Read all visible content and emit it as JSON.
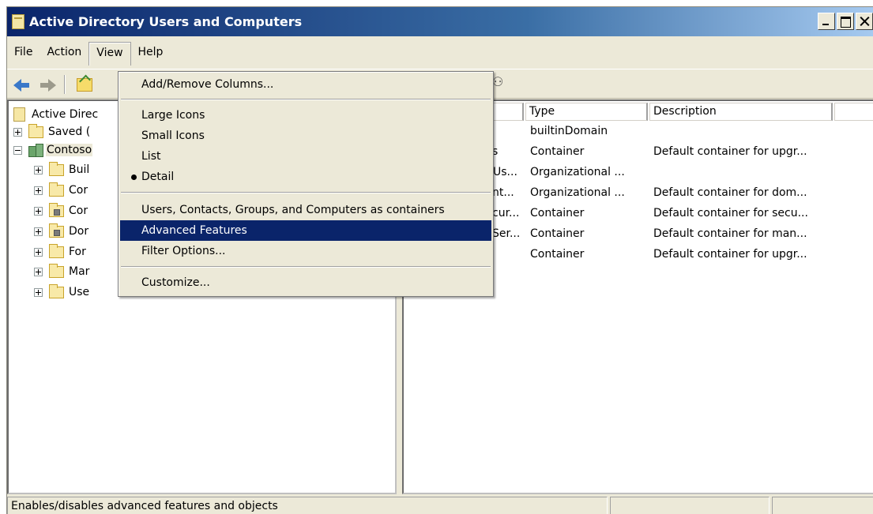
{
  "window": {
    "title": "Active Directory Users and Computers"
  },
  "menubar": {
    "items": [
      "File",
      "Action",
      "View",
      "Help"
    ]
  },
  "view_menu": {
    "items": [
      {
        "label": "Add/Remove Columns...",
        "checked": false,
        "highlighted": false
      },
      {
        "label": "Large Icons",
        "checked": false,
        "highlighted": false
      },
      {
        "label": "Small Icons",
        "checked": false,
        "highlighted": false
      },
      {
        "label": "List",
        "checked": false,
        "highlighted": false
      },
      {
        "label": "Detail",
        "checked": true,
        "highlighted": false
      },
      {
        "label": "Users, Contacts, Groups, and Computers as containers",
        "checked": false,
        "highlighted": false
      },
      {
        "label": "Advanced Features",
        "checked": false,
        "highlighted": true
      },
      {
        "label": "Filter Options...",
        "checked": false,
        "highlighted": false
      },
      {
        "label": "Customize...",
        "checked": false,
        "highlighted": false
      }
    ]
  },
  "tree": {
    "root": "Active Direc",
    "saved": "Saved (",
    "domain": "Contoso",
    "children": [
      "Buil",
      "Cor",
      "Cor",
      "Dor",
      "For",
      "Mar",
      "Use"
    ]
  },
  "list": {
    "columns": [
      "Type",
      "Description"
    ],
    "rows": [
      {
        "name": "",
        "type": "builtinDomain",
        "description": ""
      },
      {
        "name": "s",
        "type": "Container",
        "description": "Default container for upgr..."
      },
      {
        "name": "Us...",
        "type": "Organizational ...",
        "description": ""
      },
      {
        "name": "nt...",
        "type": "Organizational ...",
        "description": "Default container for dom..."
      },
      {
        "name": "cur...",
        "type": "Container",
        "description": "Default container for secu..."
      },
      {
        "name": "Ser...",
        "type": "Container",
        "description": "Default container for man..."
      },
      {
        "name": "",
        "type": "Container",
        "description": "Default container for upgr..."
      }
    ]
  },
  "statusbar": {
    "text": "Enables/disables advanced features and objects"
  },
  "colors": {
    "selection": "#0a246a",
    "title_start": "#0a246a",
    "title_end": "#a6caf0"
  }
}
